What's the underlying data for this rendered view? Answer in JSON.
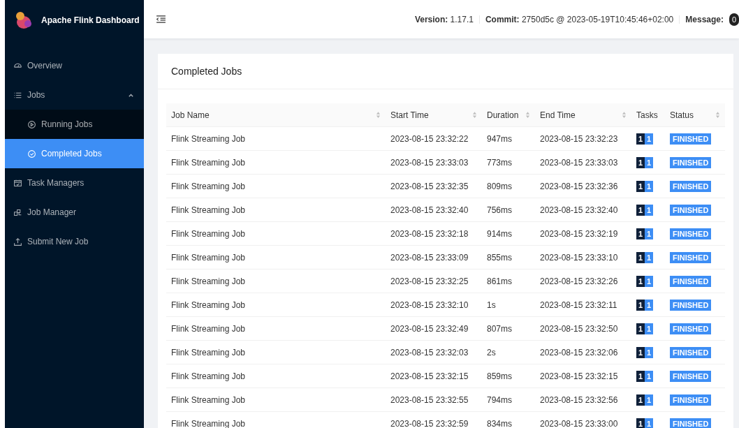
{
  "sidebar": {
    "title": "Apache Flink Dashboard",
    "items": [
      {
        "label": "Overview",
        "selected": false
      },
      {
        "label": "Jobs",
        "selected": false,
        "expanded": true,
        "children": [
          {
            "label": "Running Jobs",
            "selected": false
          },
          {
            "label": "Completed Jobs",
            "selected": true
          }
        ]
      },
      {
        "label": "Task Managers",
        "selected": false
      },
      {
        "label": "Job Manager",
        "selected": false
      },
      {
        "label": "Submit New Job",
        "selected": false
      }
    ]
  },
  "header": {
    "version_label": "Version:",
    "version": "1.17.1",
    "commit_label": "Commit:",
    "commit": "2750d5c @ 2023-05-19T10:45:46+02:00",
    "message_label": "Message:",
    "message_count": "0"
  },
  "card": {
    "title": "Completed Jobs"
  },
  "table": {
    "columns": [
      {
        "label": "Job Name",
        "sortable": true
      },
      {
        "label": "Start Time",
        "sortable": true
      },
      {
        "label": "Duration",
        "sortable": true
      },
      {
        "label": "End Time",
        "sortable": true
      },
      {
        "label": "Tasks",
        "sortable": false
      },
      {
        "label": "Status",
        "sortable": true
      }
    ],
    "rows": [
      {
        "name": "Flink Streaming Job",
        "start": "2023-08-15 23:32:22",
        "duration": "947ms",
        "end": "2023-08-15 23:32:23",
        "tasks": [
          "1",
          "1"
        ],
        "status": "FINISHED"
      },
      {
        "name": "Flink Streaming Job",
        "start": "2023-08-15 23:33:03",
        "duration": "773ms",
        "end": "2023-08-15 23:33:03",
        "tasks": [
          "1",
          "1"
        ],
        "status": "FINISHED"
      },
      {
        "name": "Flink Streaming Job",
        "start": "2023-08-15 23:32:35",
        "duration": "809ms",
        "end": "2023-08-15 23:32:36",
        "tasks": [
          "1",
          "1"
        ],
        "status": "FINISHED"
      },
      {
        "name": "Flink Streaming Job",
        "start": "2023-08-15 23:32:40",
        "duration": "756ms",
        "end": "2023-08-15 23:32:40",
        "tasks": [
          "1",
          "1"
        ],
        "status": "FINISHED"
      },
      {
        "name": "Flink Streaming Job",
        "start": "2023-08-15 23:32:18",
        "duration": "914ms",
        "end": "2023-08-15 23:32:19",
        "tasks": [
          "1",
          "1"
        ],
        "status": "FINISHED"
      },
      {
        "name": "Flink Streaming Job",
        "start": "2023-08-15 23:33:09",
        "duration": "855ms",
        "end": "2023-08-15 23:33:10",
        "tasks": [
          "1",
          "1"
        ],
        "status": "FINISHED"
      },
      {
        "name": "Flink Streaming Job",
        "start": "2023-08-15 23:32:25",
        "duration": "861ms",
        "end": "2023-08-15 23:32:26",
        "tasks": [
          "1",
          "1"
        ],
        "status": "FINISHED"
      },
      {
        "name": "Flink Streaming Job",
        "start": "2023-08-15 23:32:10",
        "duration": "1s",
        "end": "2023-08-15 23:32:11",
        "tasks": [
          "1",
          "1"
        ],
        "status": "FINISHED"
      },
      {
        "name": "Flink Streaming Job",
        "start": "2023-08-15 23:32:49",
        "duration": "807ms",
        "end": "2023-08-15 23:32:50",
        "tasks": [
          "1",
          "1"
        ],
        "status": "FINISHED"
      },
      {
        "name": "Flink Streaming Job",
        "start": "2023-08-15 23:32:03",
        "duration": "2s",
        "end": "2023-08-15 23:32:06",
        "tasks": [
          "1",
          "1"
        ],
        "status": "FINISHED"
      },
      {
        "name": "Flink Streaming Job",
        "start": "2023-08-15 23:32:15",
        "duration": "859ms",
        "end": "2023-08-15 23:32:15",
        "tasks": [
          "1",
          "1"
        ],
        "status": "FINISHED"
      },
      {
        "name": "Flink Streaming Job",
        "start": "2023-08-15 23:32:55",
        "duration": "794ms",
        "end": "2023-08-15 23:32:56",
        "tasks": [
          "1",
          "1"
        ],
        "status": "FINISHED"
      },
      {
        "name": "Flink Streaming Job",
        "start": "2023-08-15 23:32:59",
        "duration": "834ms",
        "end": "2023-08-15 23:33:00",
        "tasks": [
          "1",
          "1"
        ],
        "status": "FINISHED"
      }
    ]
  }
}
